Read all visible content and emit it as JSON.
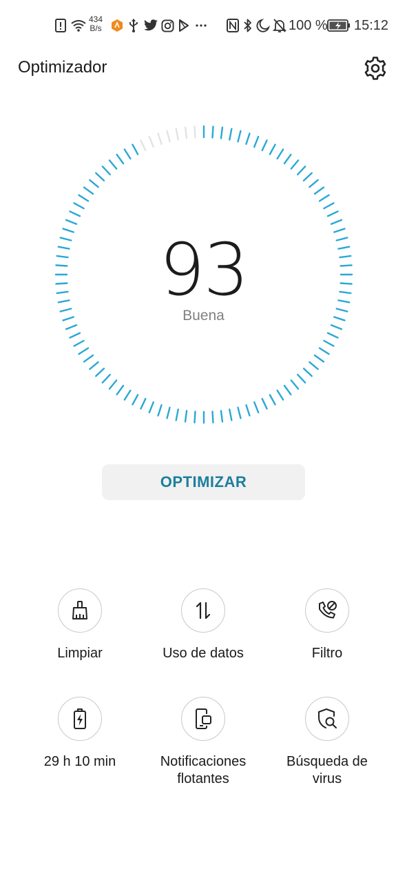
{
  "status_bar": {
    "net_speed_value": "434",
    "net_speed_unit": "B/s",
    "battery_percent": "100 %",
    "time": "15:12",
    "left_icons": [
      "alert-icon",
      "wifi-icon",
      "orange-app-icon",
      "usb-icon",
      "twitter-icon",
      "instagram-icon",
      "play-store-icon",
      "more-icon"
    ],
    "right_icons": [
      "nfc-icon",
      "bluetooth-icon",
      "moon-icon",
      "bell-off-icon",
      "battery-charging-icon"
    ]
  },
  "header": {
    "title": "Optimizador",
    "settings_icon": "gear-icon"
  },
  "gauge": {
    "score": "93",
    "status": "Buena",
    "fill_fraction": 0.93,
    "accent_color": "#29a8d6",
    "track_color": "#e3e3e3"
  },
  "optimize_button": {
    "label": "OPTIMIZAR",
    "color": "#1c7f9c"
  },
  "tools": [
    {
      "label": "Limpiar",
      "icon": "broom-icon"
    },
    {
      "label": "Uso de datos",
      "icon": "data-arrows-icon"
    },
    {
      "label": "Filtro",
      "icon": "phone-block-icon"
    },
    {
      "label": "29 h 10 min",
      "icon": "battery-icon"
    },
    {
      "label": "Notificaciones\nflotantes",
      "icon": "floating-notification-icon"
    },
    {
      "label": "Búsqueda de\nvirus",
      "icon": "shield-search-icon"
    }
  ]
}
